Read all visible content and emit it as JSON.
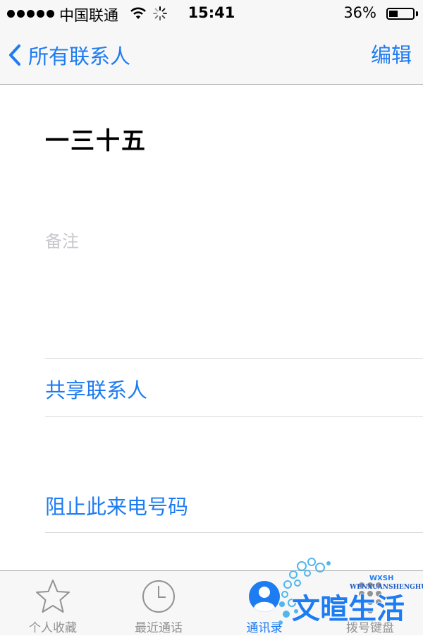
{
  "status_bar": {
    "carrier": "中国联通",
    "time": "15:41",
    "battery_percent_text": "36%",
    "battery_level": 0.36
  },
  "nav": {
    "back_label": "所有联系人",
    "edit_label": "编辑"
  },
  "contact": {
    "name": "一三十五",
    "notes_placeholder": "备注"
  },
  "actions": {
    "share": "共享联系人",
    "block": "阻止此来电号码"
  },
  "tabs": [
    {
      "label": "个人收藏",
      "icon": "star-icon"
    },
    {
      "label": "最近通话",
      "icon": "clock-icon"
    },
    {
      "label": "通讯录",
      "icon": "contacts-icon"
    },
    {
      "label": "拨号键盘",
      "icon": "keypad-icon"
    }
  ],
  "watermark": {
    "text": "文暄生活",
    "subtext": "WENXUANSHENGHUO",
    "letters": "WXSH"
  },
  "colors": {
    "accent": "#1e7cf2",
    "inactive_tab": "#929292",
    "placeholder": "#c7c7cc"
  }
}
